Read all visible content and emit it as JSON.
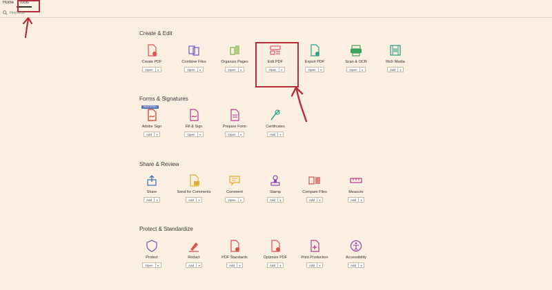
{
  "nav": {
    "tabs": [
      {
        "label": "Home"
      },
      {
        "label": "Tools"
      }
    ]
  },
  "search": {
    "placeholder": "Find tools"
  },
  "sections": [
    {
      "title": "Create & Edit",
      "tools": [
        {
          "label": "Create PDF",
          "button": "Open",
          "icon": "create-pdf-icon",
          "color": "#d9534f"
        },
        {
          "label": "Combine Files",
          "button": "Open",
          "icon": "combine-files-icon",
          "color": "#6a5acd"
        },
        {
          "label": "Organize Pages",
          "button": "Open",
          "icon": "organize-pages-icon",
          "color": "#7cb342"
        },
        {
          "label": "Edit PDF",
          "button": "Open",
          "icon": "edit-pdf-icon",
          "color": "#e05a6d"
        },
        {
          "label": "Export PDF",
          "button": "Open",
          "icon": "export-pdf-icon",
          "color": "#2e9e88"
        },
        {
          "label": "Scan & OCR",
          "button": "Open",
          "icon": "scan-ocr-icon",
          "color": "#3ca55c"
        },
        {
          "label": "Rich Media",
          "button": "Add",
          "icon": "rich-media-icon",
          "color": "#2e9e88"
        }
      ]
    },
    {
      "title": "Forms & Signatures",
      "tools": [
        {
          "label": "Adobe Sign",
          "button": "Add",
          "icon": "adobe-sign-icon",
          "color": "#c0392b",
          "badge": "FEATURED"
        },
        {
          "label": "Fill & Sign",
          "button": "Open",
          "icon": "fill-sign-icon",
          "color": "#b23a8e"
        },
        {
          "label": "Prepare Form",
          "button": "Open",
          "icon": "prepare-form-icon",
          "color": "#b23a8e"
        },
        {
          "label": "Certificates",
          "button": "Add",
          "icon": "certificates-icon",
          "color": "#2e9e88"
        }
      ]
    },
    {
      "title": "Share & Review",
      "tools": [
        {
          "label": "Share",
          "button": "Add",
          "icon": "share-icon",
          "color": "#3b6fb6"
        },
        {
          "label": "Send for Comments",
          "button": "Add",
          "icon": "send-for-comments-icon",
          "color": "#e0b12e"
        },
        {
          "label": "Comment",
          "button": "Open",
          "icon": "comment-icon",
          "color": "#e0b12e"
        },
        {
          "label": "Stamp",
          "button": "Add",
          "icon": "stamp-icon",
          "color": "#8e44ad"
        },
        {
          "label": "Compare Files",
          "button": "Add",
          "icon": "compare-files-icon",
          "color": "#d9534f"
        },
        {
          "label": "Measure",
          "button": "Add",
          "icon": "measure-icon",
          "color": "#b23a8e"
        }
      ]
    },
    {
      "title": "Protect & Standardize",
      "tools": [
        {
          "label": "Protect",
          "button": "Open",
          "icon": "protect-icon",
          "color": "#7b5ea7"
        },
        {
          "label": "Redact",
          "button": "Add",
          "icon": "redact-icon",
          "color": "#d9534f"
        },
        {
          "label": "PDF Standards",
          "button": "Add",
          "icon": "pdf-standards-icon",
          "color": "#d9534f"
        },
        {
          "label": "Optimize PDF",
          "button": "Add",
          "icon": "optimize-pdf-icon",
          "color": "#d9534f"
        },
        {
          "label": "Print Production",
          "button": "Add",
          "icon": "print-production-icon",
          "color": "#b23a8e"
        },
        {
          "label": "Accessibility",
          "button": "Add",
          "icon": "accessibility-icon",
          "color": "#8e44ad"
        }
      ]
    }
  ]
}
